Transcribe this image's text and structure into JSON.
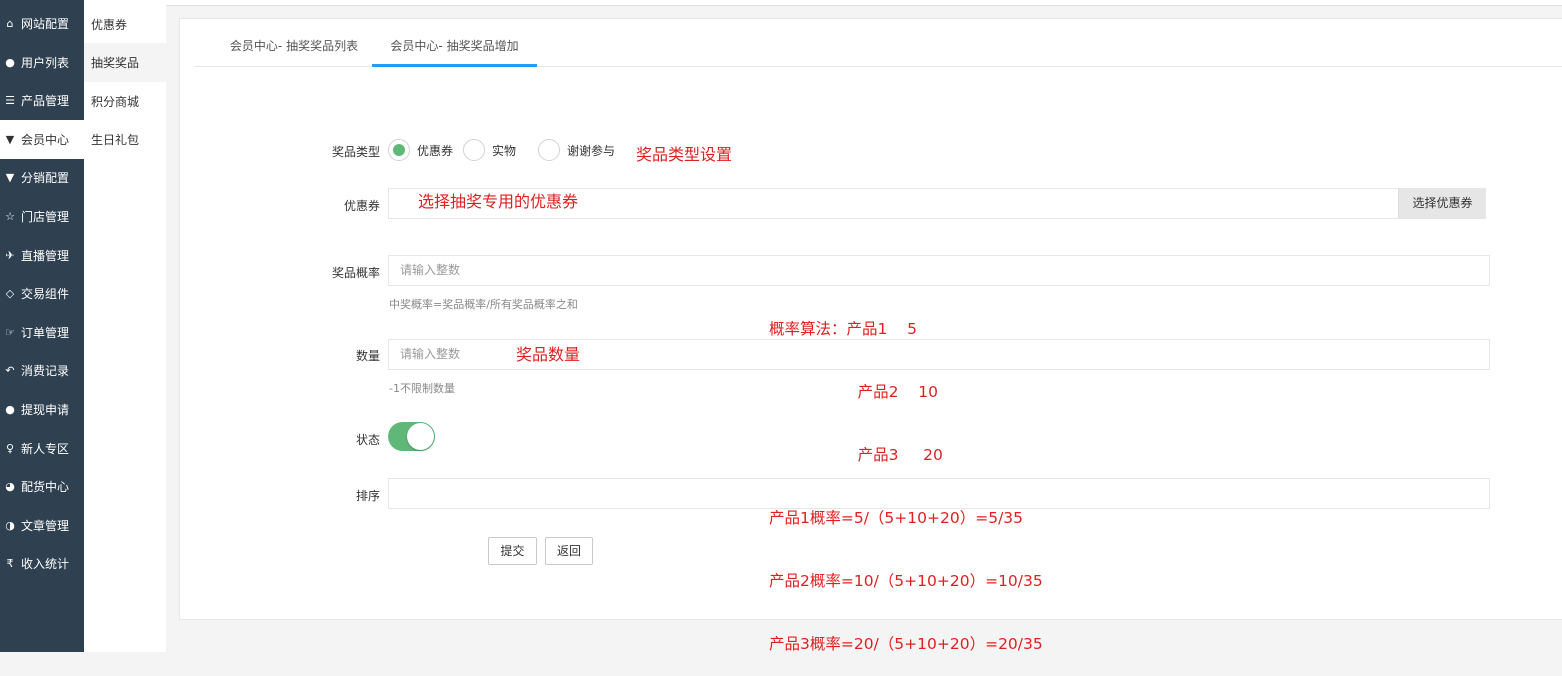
{
  "sidebar": {
    "items": [
      {
        "icon": "home-icon",
        "glyph": "⌂",
        "label": "网站配置"
      },
      {
        "icon": "user-icon",
        "glyph": "👤",
        "label": "用户列表"
      },
      {
        "icon": "list-icon",
        "glyph": "☰",
        "label": "产品管理"
      },
      {
        "icon": "cart-icon",
        "glyph": "▼",
        "label": "会员中心"
      },
      {
        "icon": "cart-icon",
        "glyph": "▼",
        "label": "分销配置"
      },
      {
        "icon": "star-icon",
        "glyph": "☆",
        "label": "门店管理"
      },
      {
        "icon": "plane-icon",
        "glyph": "✈",
        "label": "直播管理"
      },
      {
        "icon": "eraser-icon",
        "glyph": "◇",
        "label": "交易组件"
      },
      {
        "icon": "hand-icon",
        "glyph": "☞",
        "label": "订单管理"
      },
      {
        "icon": "reply-icon",
        "glyph": "↶",
        "label": "消费记录"
      },
      {
        "icon": "wechat-icon",
        "glyph": "●",
        "label": "提现申请"
      },
      {
        "icon": "pin-icon",
        "glyph": "♀",
        "label": "新人专区"
      },
      {
        "icon": "pie-icon",
        "glyph": "◕",
        "label": "配货中心"
      },
      {
        "icon": "contrast-icon",
        "glyph": "◑",
        "label": "文章管理"
      },
      {
        "icon": "rupee-icon",
        "glyph": "₹",
        "label": "收入统计"
      }
    ],
    "active_index": 3
  },
  "subnav": {
    "items": [
      "优惠券",
      "抽奖奖品",
      "积分商城",
      "生日礼包"
    ],
    "active_index": 1
  },
  "tabs": [
    {
      "label": "会员中心- 抽奖奖品列表"
    },
    {
      "label": "会员中心- 抽奖奖品增加"
    }
  ],
  "form": {
    "prize_type": {
      "label": "奖品类型",
      "options": [
        "优惠券",
        "实物",
        "谢谢参与"
      ],
      "selected": "优惠券"
    },
    "coupon": {
      "label": "优惠券",
      "value": "",
      "button": "选择优惠券"
    },
    "probability": {
      "label": "奖品概率",
      "placeholder": "请输入整数",
      "hint": "中奖概率=奖品概率/所有奖品概率之和"
    },
    "quantity": {
      "label": "数量",
      "placeholder": "请输入整数",
      "hint": "-1不限制数量"
    },
    "status": {
      "label": "状态",
      "on": true
    },
    "sort": {
      "label": "排序",
      "value": ""
    },
    "submit": "提交",
    "back": "返回"
  },
  "annotations": {
    "type_setting": "奖品类型设置",
    "coupon_note": "选择抽奖专用的优惠券",
    "quantity_note": "奖品数量",
    "formula_lines": [
      "概率算法：产品1    5",
      "                  产品2    10",
      "                  产品3     20",
      "产品1概率=5/（5+10+20）=5/35",
      "产品2概率=10/（5+10+20）=10/35",
      "产品3概率=20/（5+10+20）=20/35"
    ],
    "color": "#e02020"
  },
  "colors": {
    "sidebar_bg": "#2f4050",
    "accent_green": "#5fb878",
    "tab_active": "#1e9fff"
  }
}
